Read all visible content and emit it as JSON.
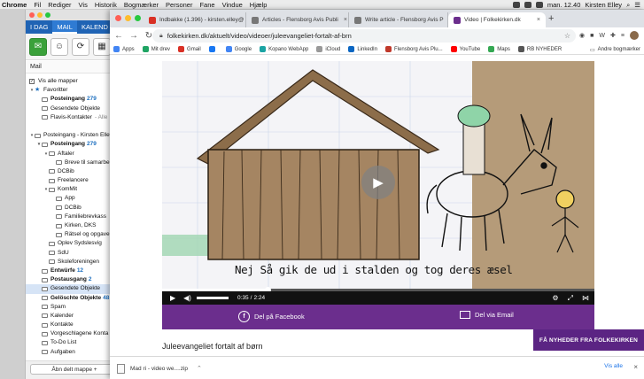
{
  "menubar": {
    "app": "Chrome",
    "items": [
      "Fil",
      "Rediger",
      "Vis",
      "Historik",
      "Bogmærker",
      "Personer",
      "Fane",
      "Vindue",
      "Hjælp"
    ],
    "clock": "man. 12.40",
    "user": "Kirsten Elley"
  },
  "mail": {
    "tabs": [
      "I DAG",
      "MAIL",
      "KALEND"
    ],
    "section_label": "Mail",
    "show_all_folders": "Vis alle mapper",
    "folders": [
      {
        "label": "Favoritter",
        "level": 0,
        "twisty": "▾",
        "icon": "star-icon"
      },
      {
        "label": "Posteingang",
        "count": "279",
        "level": 1,
        "bold": true,
        "icon": "folder-icon"
      },
      {
        "label": "Gesendete Objekte",
        "level": 1,
        "icon": "folder-icon"
      },
      {
        "label": "Flavis-Kontakter",
        "suffix": "- Alle",
        "level": 1,
        "icon": "folder-icon"
      },
      {
        "label": "",
        "level": 0
      },
      {
        "label": "Posteingang - Kirsten Elley",
        "level": 0,
        "twisty": "▾",
        "icon": "house-icon"
      },
      {
        "label": "Posteingang",
        "count": "279",
        "level": 1,
        "twisty": "▾",
        "bold": true,
        "icon": "inbox-icon"
      },
      {
        "label": "Aftaler",
        "level": 2,
        "twisty": "▾",
        "icon": "folder-icon"
      },
      {
        "label": "Breve til samarbe",
        "level": 3,
        "icon": "folder-icon"
      },
      {
        "label": "DCBib",
        "level": 2,
        "icon": "folder-icon"
      },
      {
        "label": "Freelancere",
        "level": 2,
        "icon": "folder-icon"
      },
      {
        "label": "KomMit",
        "level": 2,
        "twisty": "▾",
        "icon": "folder-icon"
      },
      {
        "label": "App",
        "level": 3,
        "icon": "folder-icon"
      },
      {
        "label": "DCBib",
        "level": 3,
        "icon": "folder-icon"
      },
      {
        "label": "Familiebrevkass",
        "level": 3,
        "icon": "folder-icon"
      },
      {
        "label": "Kirken, DKS",
        "level": 3,
        "icon": "folder-icon"
      },
      {
        "label": "Rätsel og opgave",
        "level": 3,
        "icon": "folder-icon"
      },
      {
        "label": "Oplev Sydslesvig",
        "level": 2,
        "icon": "folder-icon"
      },
      {
        "label": "SdU",
        "level": 2,
        "icon": "folder-icon"
      },
      {
        "label": "Skoleforeningen",
        "level": 2,
        "icon": "folder-icon"
      },
      {
        "label": "Entwürfe",
        "count": "12",
        "level": 1,
        "bold": true,
        "icon": "pencil-icon"
      },
      {
        "label": "Postausgang",
        "count": "2",
        "level": 1,
        "bold": true,
        "icon": "outbox-icon"
      },
      {
        "label": "Gesendete Objekte",
        "level": 1,
        "selected": true,
        "icon": "sent-icon"
      },
      {
        "label": "Gelöschte Objekte",
        "count": "48",
        "level": 1,
        "bold": true,
        "icon": "trash-icon"
      },
      {
        "label": "Spam",
        "level": 1,
        "icon": "spam-icon"
      },
      {
        "label": "Kalender",
        "level": 1,
        "icon": "calendar-icon"
      },
      {
        "label": "Kontakte",
        "level": 1,
        "icon": "contacts-icon"
      },
      {
        "label": "Vorgeschlagene Konta",
        "level": 1,
        "icon": "contacts-icon"
      },
      {
        "label": "To-Do List",
        "level": 1,
        "icon": "checklist-icon"
      },
      {
        "label": "Aufgaben",
        "level": 1,
        "icon": "tasks-icon"
      }
    ],
    "open_shared": "Åbn delt mappe +"
  },
  "chrome": {
    "tabs": [
      {
        "title": "Indbakke (1.396) - kirsten.elley@",
        "favicon_color": "#d93025",
        "active": false
      },
      {
        "title": "Articles - Flensborg Avis Publi",
        "favicon_color": "#777777",
        "active": false
      },
      {
        "title": "Write article - Flensborg Avis P",
        "favicon_color": "#777777",
        "active": false
      },
      {
        "title": "Video | Folkekirken.dk",
        "favicon_color": "#6b2e8d",
        "active": true
      }
    ],
    "new_tab": "+",
    "url": "folkekirken.dk/aktuelt/video/videoer/juleevangeliet-fortalt-af-brn",
    "bookmarks": [
      {
        "label": "Apps",
        "color": "#4285f4"
      },
      {
        "label": "Mit drev",
        "color": "#1fa463"
      },
      {
        "label": "Gmail",
        "color": "#d93025"
      },
      {
        "label": "",
        "color": "#1877f2"
      },
      {
        "label": "Google",
        "color": "#4285f4"
      },
      {
        "label": "Kopano WebApp",
        "color": "#1aa3a3"
      },
      {
        "label": "iCloud",
        "color": "#999999"
      },
      {
        "label": "LinkedIn",
        "color": "#0a66c2"
      },
      {
        "label": "Flensborg Avis Plu...",
        "color": "#c0392b"
      },
      {
        "label": "YouTube",
        "color": "#ff0000"
      },
      {
        "label": "Maps",
        "color": "#34a853"
      },
      {
        "label": "RB NYHEDER",
        "color": "#555555"
      }
    ],
    "other_bookmarks": "Andre bogmærker"
  },
  "video": {
    "subtitle": "Nej Så gik de ud i stalden og tog deres æsel",
    "current_time": "0:35",
    "duration": "2:24",
    "progress": 0.243,
    "share_facebook": "Del på Facebook",
    "share_email": "Del via Email",
    "title": "Juleevangeliet fortalt af børn"
  },
  "newsletter_button": "FÅ NYHEDER FRA FOLKEKIRKEN",
  "download": {
    "filename": "Mad ri - video we....zip",
    "show_all": "Vis alle",
    "close": "×"
  }
}
